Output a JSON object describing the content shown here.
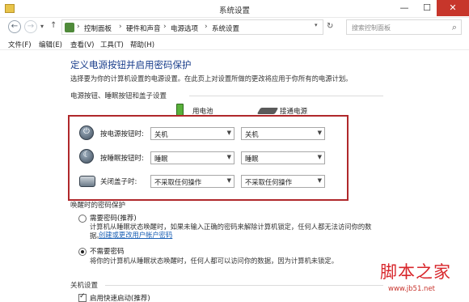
{
  "window": {
    "title": "系统设置",
    "controls": {
      "minimize": "—",
      "maximize": "☐",
      "close": "✕"
    }
  },
  "nav": {
    "back": "←",
    "forward": "→",
    "dropdown": "▾",
    "up": "↑",
    "breadcrumb": [
      "控制面板",
      "硬件和声音",
      "电源选项",
      "系统设置"
    ],
    "separator": "›",
    "refresh": "↻",
    "search_placeholder": "搜索控制面板"
  },
  "menu": [
    "文件(F)",
    "编辑(E)",
    "查看(V)",
    "工具(T)",
    "帮助(H)"
  ],
  "main": {
    "heading": "定义电源按钮并启用密码保护",
    "description": "选择要为你的计算机设置的电源设置。在此页上对设置所做的更改将应用于你所有的电源计划。",
    "section_buttons": "电源按钮、睡眠按钮和盖子设置",
    "col_battery": "用电池",
    "col_plugged": "接通电源",
    "rows": [
      {
        "label": "按电源按钮时:",
        "battery": "关机",
        "plugged": "关机",
        "icon": "power-icon"
      },
      {
        "label": "按睡眠按钮时:",
        "battery": "睡眠",
        "plugged": "睡眠",
        "icon": "sleep-icon"
      },
      {
        "label": "关闭盖子时:",
        "battery": "不采取任何操作",
        "plugged": "不采取任何操作",
        "icon": "laptop-lid-icon"
      }
    ],
    "section_password": "唤醒时的密码保护",
    "opt_require": "需要密码(推荐)",
    "opt_require_desc": "计算机从睡眠状态唤醒时，如果未输入正确的密码来解除计算机锁定，任何人都无法访问你的数",
    "opt_require_desc2": "据。",
    "link_account": "创建或更改用户帐户密码",
    "opt_norequire": "不需要密码",
    "opt_norequire_desc": "将你的计算机从睡眠状态唤醒时，任何人都可以访问你的数据，因为计算机未锁定。",
    "section_shutdown": "关机设置",
    "checkbox_fast": "启用快速启动(推荐)"
  },
  "watermark": {
    "main": "脚本之家",
    "url": "www.jb51.net"
  },
  "colors": {
    "accent_heading": "#1a3e8c",
    "highlight_border": "#b0282b",
    "close_button": "#c7362b",
    "watermark": "#d8262b"
  }
}
